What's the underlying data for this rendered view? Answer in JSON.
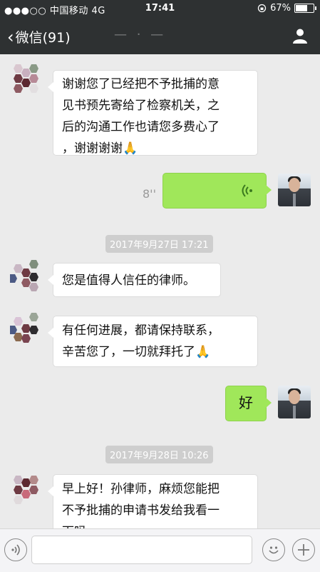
{
  "status_bar": {
    "carrier": "●●●○○ 中国移动  4G",
    "time": "17:41",
    "battery": "67%",
    "battery_level": 0.67
  },
  "nav": {
    "back_label": "微信(91)",
    "title": "— · —"
  },
  "messages": {
    "m1": {
      "line1": "谢谢您了已经把不予批捕的意",
      "line2": "见书预先寄给了检察机关，之",
      "line3": "后的沟通工作也请您多费心了",
      "line4": "，谢谢谢谢"
    },
    "voice": {
      "duration": "8''"
    },
    "ts1": "2017年9月27日 17:21",
    "m2": "您是值得人信任的律师。",
    "m3": {
      "line1": "有任何进展，都请保持联系，",
      "line2": "辛苦您了，一切就拜托了"
    },
    "m4": "好",
    "ts2": "2017年9月28日 10:26",
    "m5": {
      "line1": "早上好！孙律师，麻烦您能把",
      "line2": "不予批捕的申请书发给我看一",
      "line3": "下吗"
    }
  },
  "icons": {
    "pray": "🙏",
    "voice": "voice-icon",
    "emoji": "emoji-icon",
    "plus": "plus-icon"
  }
}
